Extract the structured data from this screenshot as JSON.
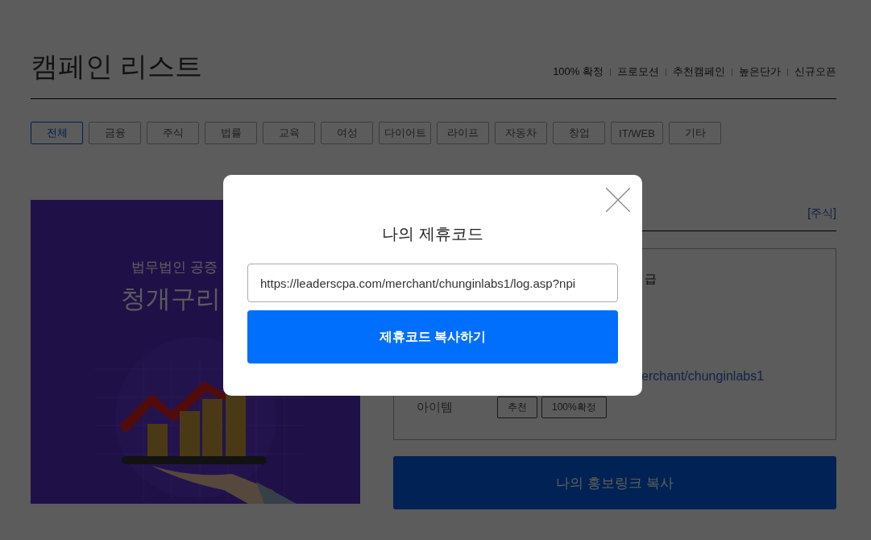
{
  "page": {
    "title": "캠페인 리스트",
    "nav_links": [
      "100% 확정",
      "프로모션",
      "추천캠페인",
      "높은단가",
      "신규오픈"
    ],
    "categories": [
      {
        "label": "전체",
        "selected": true
      },
      {
        "label": "금융",
        "selected": false
      },
      {
        "label": "주식",
        "selected": false
      },
      {
        "label": "법률",
        "selected": false
      },
      {
        "label": "교육",
        "selected": false
      },
      {
        "label": "여성",
        "selected": false
      },
      {
        "label": "다이어트",
        "selected": false
      },
      {
        "label": "라이프",
        "selected": false
      },
      {
        "label": "자동차",
        "selected": false
      },
      {
        "label": "창업",
        "selected": false
      },
      {
        "label": "IT/WEB",
        "selected": false
      },
      {
        "label": "기타",
        "selected": false
      }
    ]
  },
  "campaign": {
    "banner": {
      "kind": "picture",
      "subtitle": "법무법인 공증",
      "headline": "청개구리"
    },
    "category_tag": "[주식]",
    "details": {
      "row_1": "급",
      "link": "erchant/chunginlabs1",
      "items_label": "아이템",
      "items": [
        "추천",
        "100%확정"
      ]
    },
    "promo_button": "나의 홍보링크 복사"
  },
  "modal": {
    "title": "나의 제휴코드",
    "code_field": {
      "value": "https://leaderscpa.com/merchant/chunginlabs1/log.asp?npi"
    },
    "copy_button": "제휴코드 복사하기"
  }
}
